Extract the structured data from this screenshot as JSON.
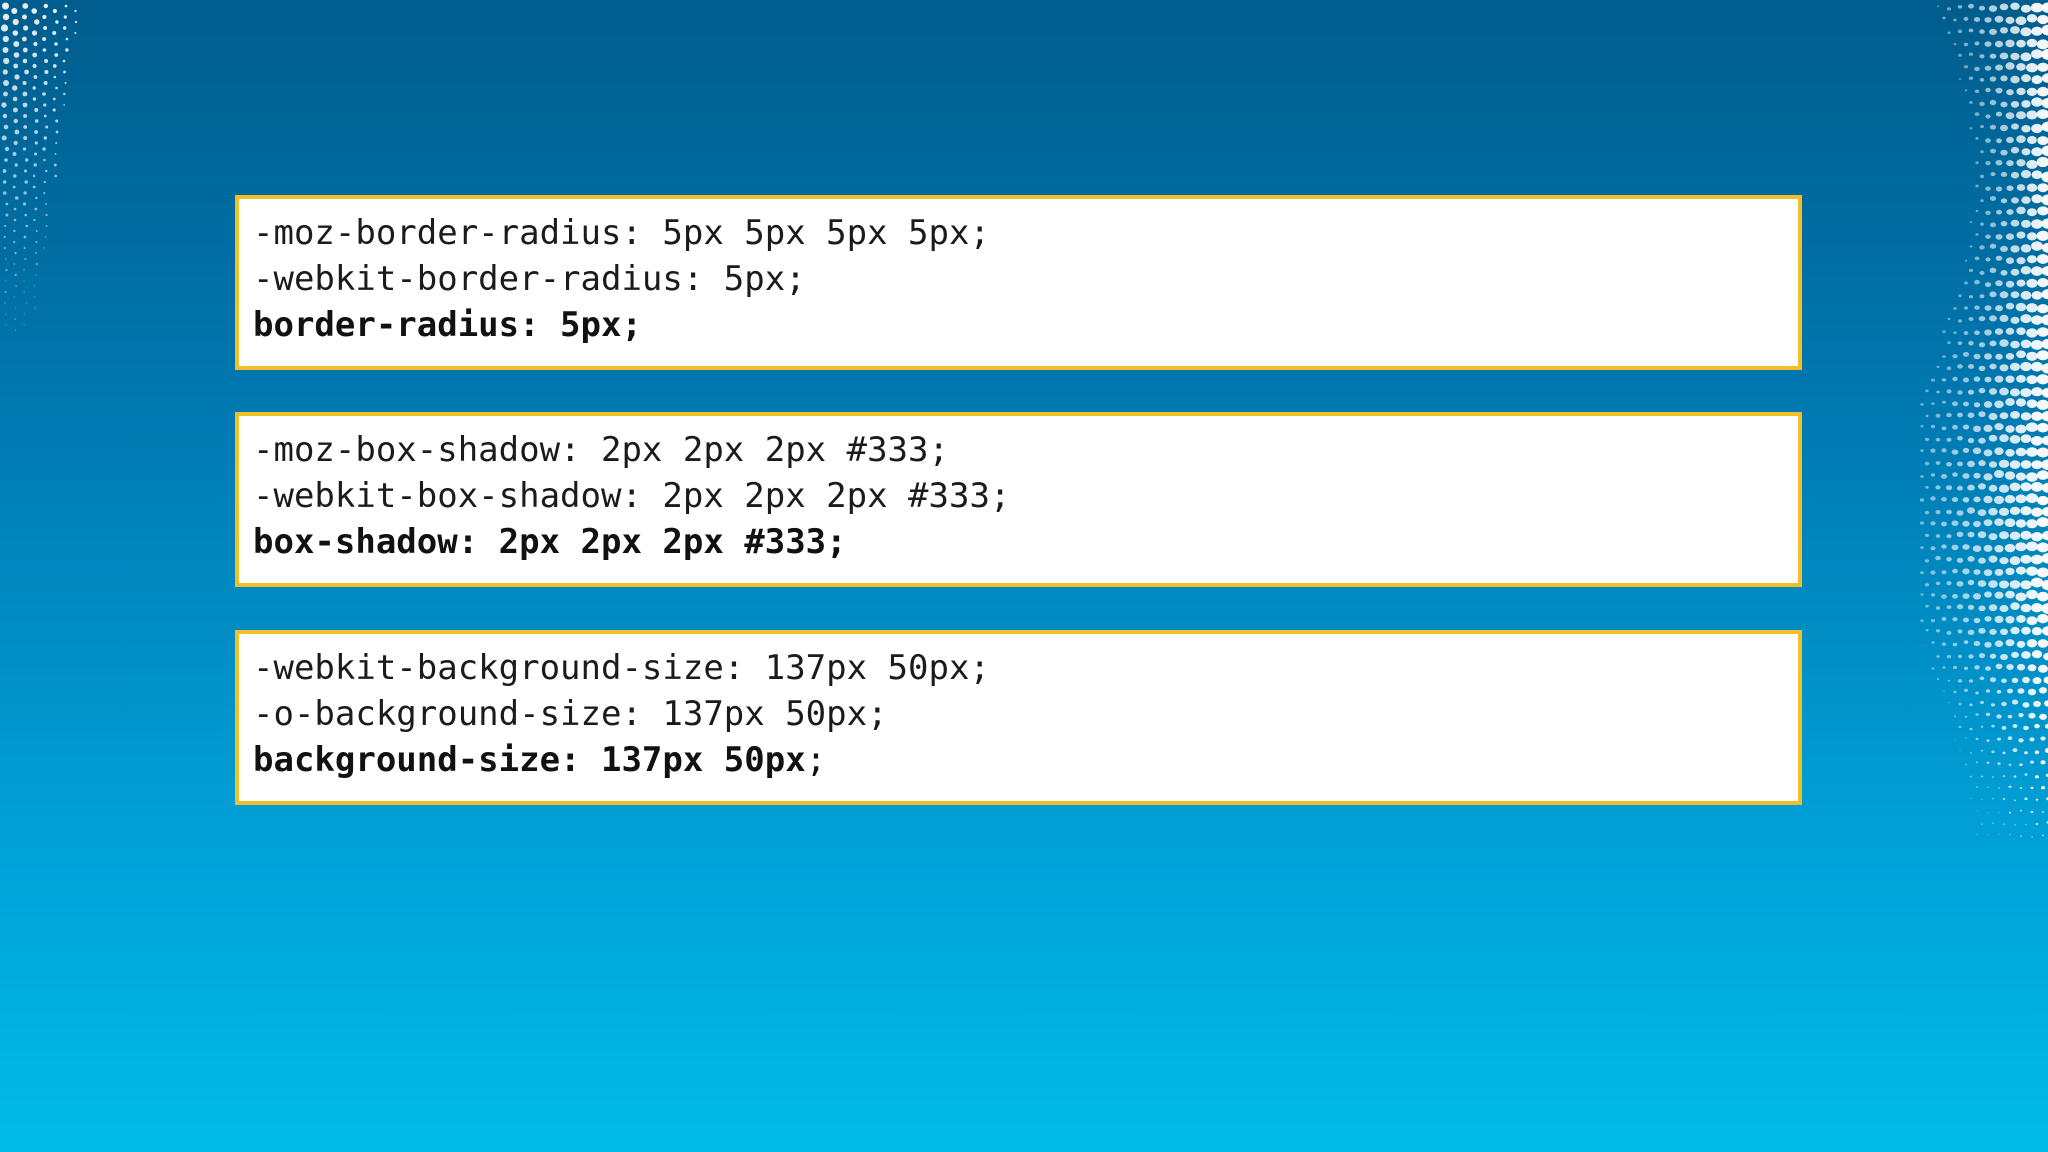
{
  "slide": {
    "background_colors": [
      "#005d8d",
      "#00bbe8"
    ],
    "box_border_color": "#f2be2a",
    "code_blocks": [
      {
        "lines": [
          "-moz-border-radius: 5px 5px 5px 5px;",
          "-webkit-border-radius: 5px;"
        ],
        "standard_line": "border-radius: 5px;",
        "standard_line_suffix": ""
      },
      {
        "lines": [
          "-moz-box-shadow: 2px 2px 2px #333;",
          "-webkit-box-shadow: 2px 2px 2px #333;"
        ],
        "standard_line": "box-shadow: 2px 2px 2px #333;",
        "standard_line_suffix": ""
      },
      {
        "lines": [
          "-webkit-background-size: 137px 50px;",
          "-o-background-size: 137px 50px;"
        ],
        "standard_line": "background-size: 137px 50px",
        "standard_line_suffix": ";"
      }
    ]
  }
}
